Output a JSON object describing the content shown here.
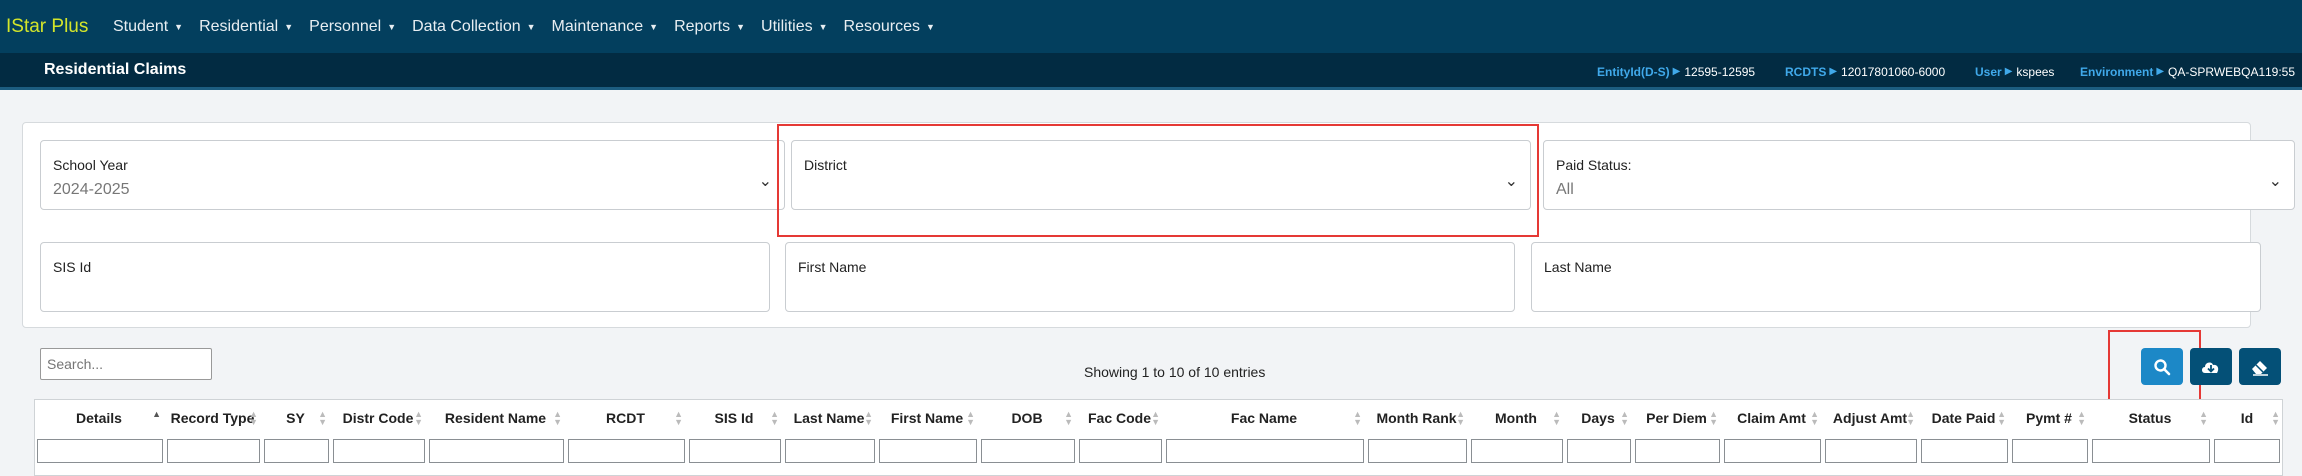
{
  "app": {
    "brand": "IStar Plus"
  },
  "menu": [
    {
      "label": "Student"
    },
    {
      "label": "Residential"
    },
    {
      "label": "Personnel"
    },
    {
      "label": "Data Collection"
    },
    {
      "label": "Maintenance"
    },
    {
      "label": "Reports"
    },
    {
      "label": "Utilities"
    },
    {
      "label": "Resources"
    }
  ],
  "header": {
    "title": "Residential Claims",
    "entity_label": "EntityId(D-S)",
    "entity_value": "12595-12595",
    "rcdts_label": "RCDTS",
    "rcdts_value": "12017801060-6000",
    "user_label": "User",
    "user_value": "kspees",
    "env_label": "Environment",
    "env_value": "QA-SPRWEBQA1",
    "time": "19:55"
  },
  "filters": {
    "school_year": {
      "label": "School Year",
      "value": "2024-2025"
    },
    "district": {
      "label": "District",
      "value": ""
    },
    "paid_status": {
      "label": "Paid Status:",
      "value": "All"
    },
    "sis_id": {
      "label": "SIS Id"
    },
    "first_name": {
      "label": "First Name"
    },
    "last_name": {
      "label": "Last Name"
    }
  },
  "table_tools": {
    "search_placeholder": "Search...",
    "showing": "Showing 1 to 10 of 10 entries"
  },
  "columns": [
    "Details",
    "Record Type",
    "SY",
    "Distr Code",
    "Resident Name",
    "RCDT",
    "SIS Id",
    "Last Name",
    "First Name",
    "DOB",
    "Fac Code",
    "Fac Name",
    "Month Rank",
    "Month",
    "Days",
    "Per Diem",
    "Claim Amt",
    "Adjust Amt",
    "Date Paid",
    "Pymt #",
    "Status",
    "Id"
  ],
  "colors": {
    "nav_bg": "#033f5e",
    "subbar_bg": "#022b42",
    "brand": "#d4e62a",
    "accent": "#40a9ea",
    "primary_btn": "#1c88c7",
    "dark_btn": "#045077",
    "highlight": "#e53935"
  },
  "icons": {
    "search_button": "search-icon",
    "download_button": "cloud-download-icon",
    "clear_button": "eraser-icon"
  }
}
